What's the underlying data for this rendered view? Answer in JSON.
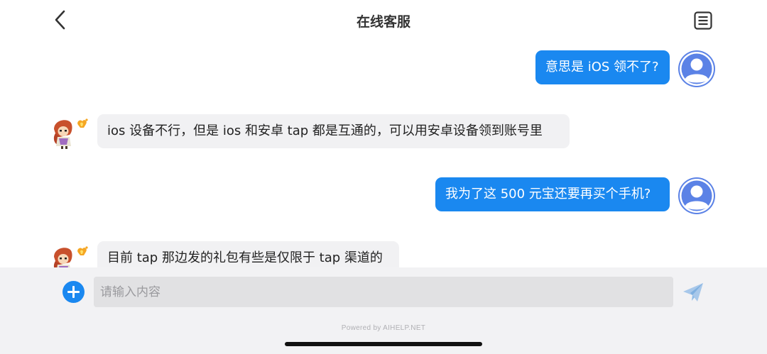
{
  "header": {
    "title": "在线客服",
    "back_icon": "chevron-left-icon",
    "menu_icon": "list-icon"
  },
  "messages": [
    {
      "from": "user",
      "text": "意思是 iOS 领不了?"
    },
    {
      "from": "agent",
      "text": "ios 设备不行，但是 ios 和安卓 tap 都是互通的，可以用安卓设备领到账号里"
    },
    {
      "from": "user",
      "text": "我为了这 500 元宝还要再买个手机?"
    },
    {
      "from": "agent",
      "text": "目前 tap 那边发的礼包有些是仅限于 tap 渠道的"
    }
  ],
  "composer": {
    "placeholder": "请输入内容",
    "value": "",
    "plus_icon": "plus-circle-icon",
    "send_icon": "send-icon"
  },
  "footer": {
    "powered_by": "Powered by AIHELP.NET"
  },
  "colors": {
    "accent": "#1a88f0",
    "user_avatar": "#5b82e6",
    "agent_bubble": "#f1f1f3",
    "composer_bg": "#f2f2f4"
  }
}
